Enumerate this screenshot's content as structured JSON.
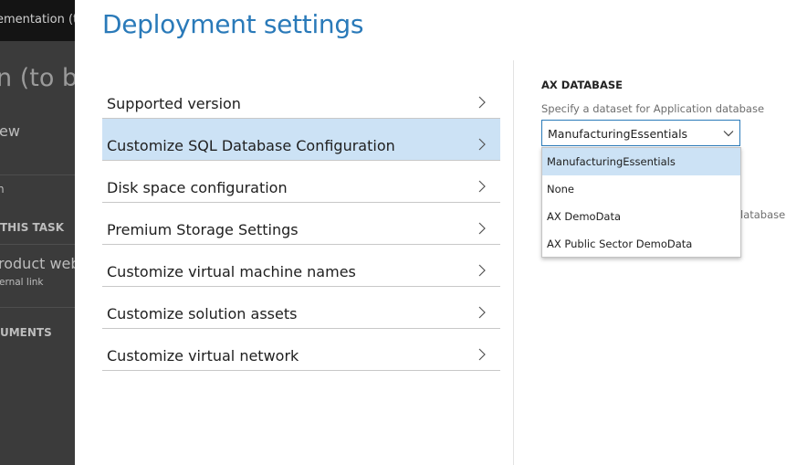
{
  "background_app": {
    "header_text": "ementation (to",
    "title_fragment": "n (to be",
    "items": [
      "ew",
      "n",
      "THIS TASK",
      "roduct web",
      "ernal link",
      "UMENTS"
    ]
  },
  "panel": {
    "title": "Deployment settings",
    "menu": [
      {
        "label": "Supported version",
        "selected": false
      },
      {
        "label": "Customize SQL Database Configuration",
        "selected": true
      },
      {
        "label": "Disk space configuration",
        "selected": false
      },
      {
        "label": "Premium Storage Settings",
        "selected": false
      },
      {
        "label": "Customize virtual machine names",
        "selected": false
      },
      {
        "label": "Customize solution assets",
        "selected": false
      },
      {
        "label": "Customize virtual network",
        "selected": false
      }
    ]
  },
  "detail": {
    "section_title": "AX DATABASE",
    "hint": "Specify a dataset for Application database",
    "obscured_hint_fragment": "latabase",
    "select": {
      "value": "ManufacturingEssentials",
      "options": [
        "ManufacturingEssentials",
        "None",
        "AX DemoData",
        "AX Public Sector DemoData"
      ],
      "highlighted_index": 0
    }
  },
  "colors": {
    "accent": "#2a7ab9",
    "selected_bg": "#cce2f5",
    "overlay": "#3b3b3b"
  },
  "icons": {
    "menu_item": "chevron-right-icon",
    "select": "chevron-down-icon"
  }
}
